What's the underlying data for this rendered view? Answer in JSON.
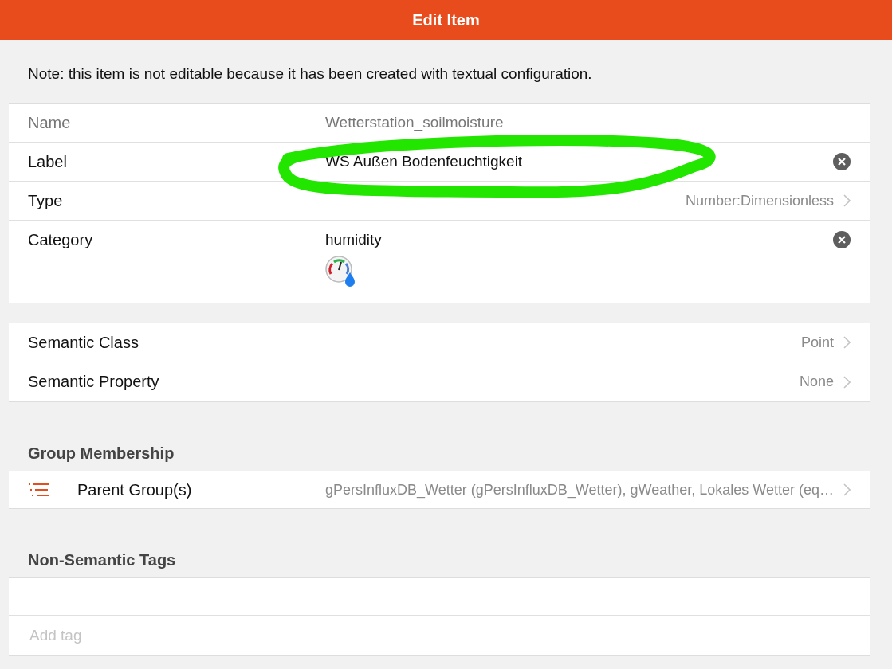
{
  "header": {
    "title": "Edit Item"
  },
  "note": "Note: this item is not editable because it has been created with textual configuration.",
  "fields": [
    {
      "kind": "readonly",
      "label": "Name",
      "value": "Wetterstation_soilmoisture"
    },
    {
      "kind": "text",
      "label": "Label",
      "value": "WS Außen Bodenfeuchtigkeit",
      "clearable": true,
      "annotated": true
    },
    {
      "kind": "link",
      "label": "Type",
      "value": "Number:Dimensionless"
    },
    {
      "kind": "text",
      "label": "Category",
      "value": "humidity",
      "clearable": true,
      "preview_icon": true
    }
  ],
  "semantics": [
    {
      "label": "Semantic Class",
      "value": "Point"
    },
    {
      "label": "Semantic Property",
      "value": "None"
    }
  ],
  "group_membership": {
    "title": "Group Membership",
    "items": [
      {
        "label": "Parent Group(s)",
        "value": "gPersInfluxDB_Wetter (gPersInfluxDB_Wetter), gWeather, Lokales Wetter (eq…"
      }
    ]
  },
  "tags": {
    "title": "Non-Semantic Tags",
    "placeholder": "Add tag"
  }
}
